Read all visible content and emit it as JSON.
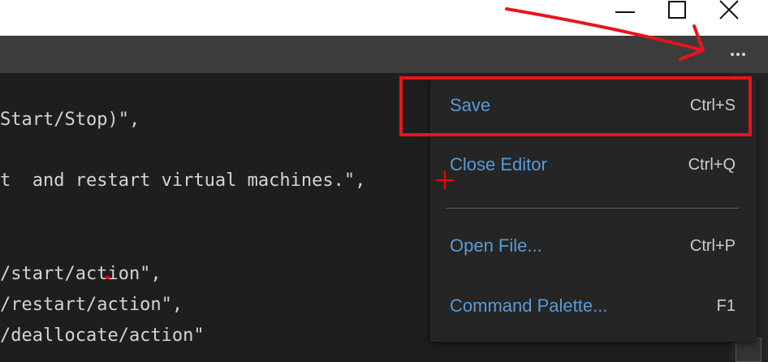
{
  "window": {
    "minimize_glyph": "—",
    "maximize_icon": "maximize-icon",
    "close_icon": "close-icon"
  },
  "tabbar": {
    "more_actions_icon": "ellipsis-icon"
  },
  "editor": {
    "lines": [
      "Start/Stop)\",",
      "t  and restart virtual machines.\",",
      "/start/action\",",
      "/restart/action\",",
      "/deallocate/action\""
    ]
  },
  "menu": {
    "items": [
      {
        "label": "Save",
        "shortcut": "Ctrl+S"
      },
      {
        "label": "Close Editor",
        "shortcut": "Ctrl+Q"
      },
      {
        "label": "Open File...",
        "shortcut": "Ctrl+P"
      },
      {
        "label": "Command Palette...",
        "shortcut": "F1"
      }
    ]
  },
  "colors": {
    "annotation": "#e8141b",
    "menu_label": "#569cd6",
    "menu_background": "#252526",
    "editor_background": "#1e1e1e"
  }
}
